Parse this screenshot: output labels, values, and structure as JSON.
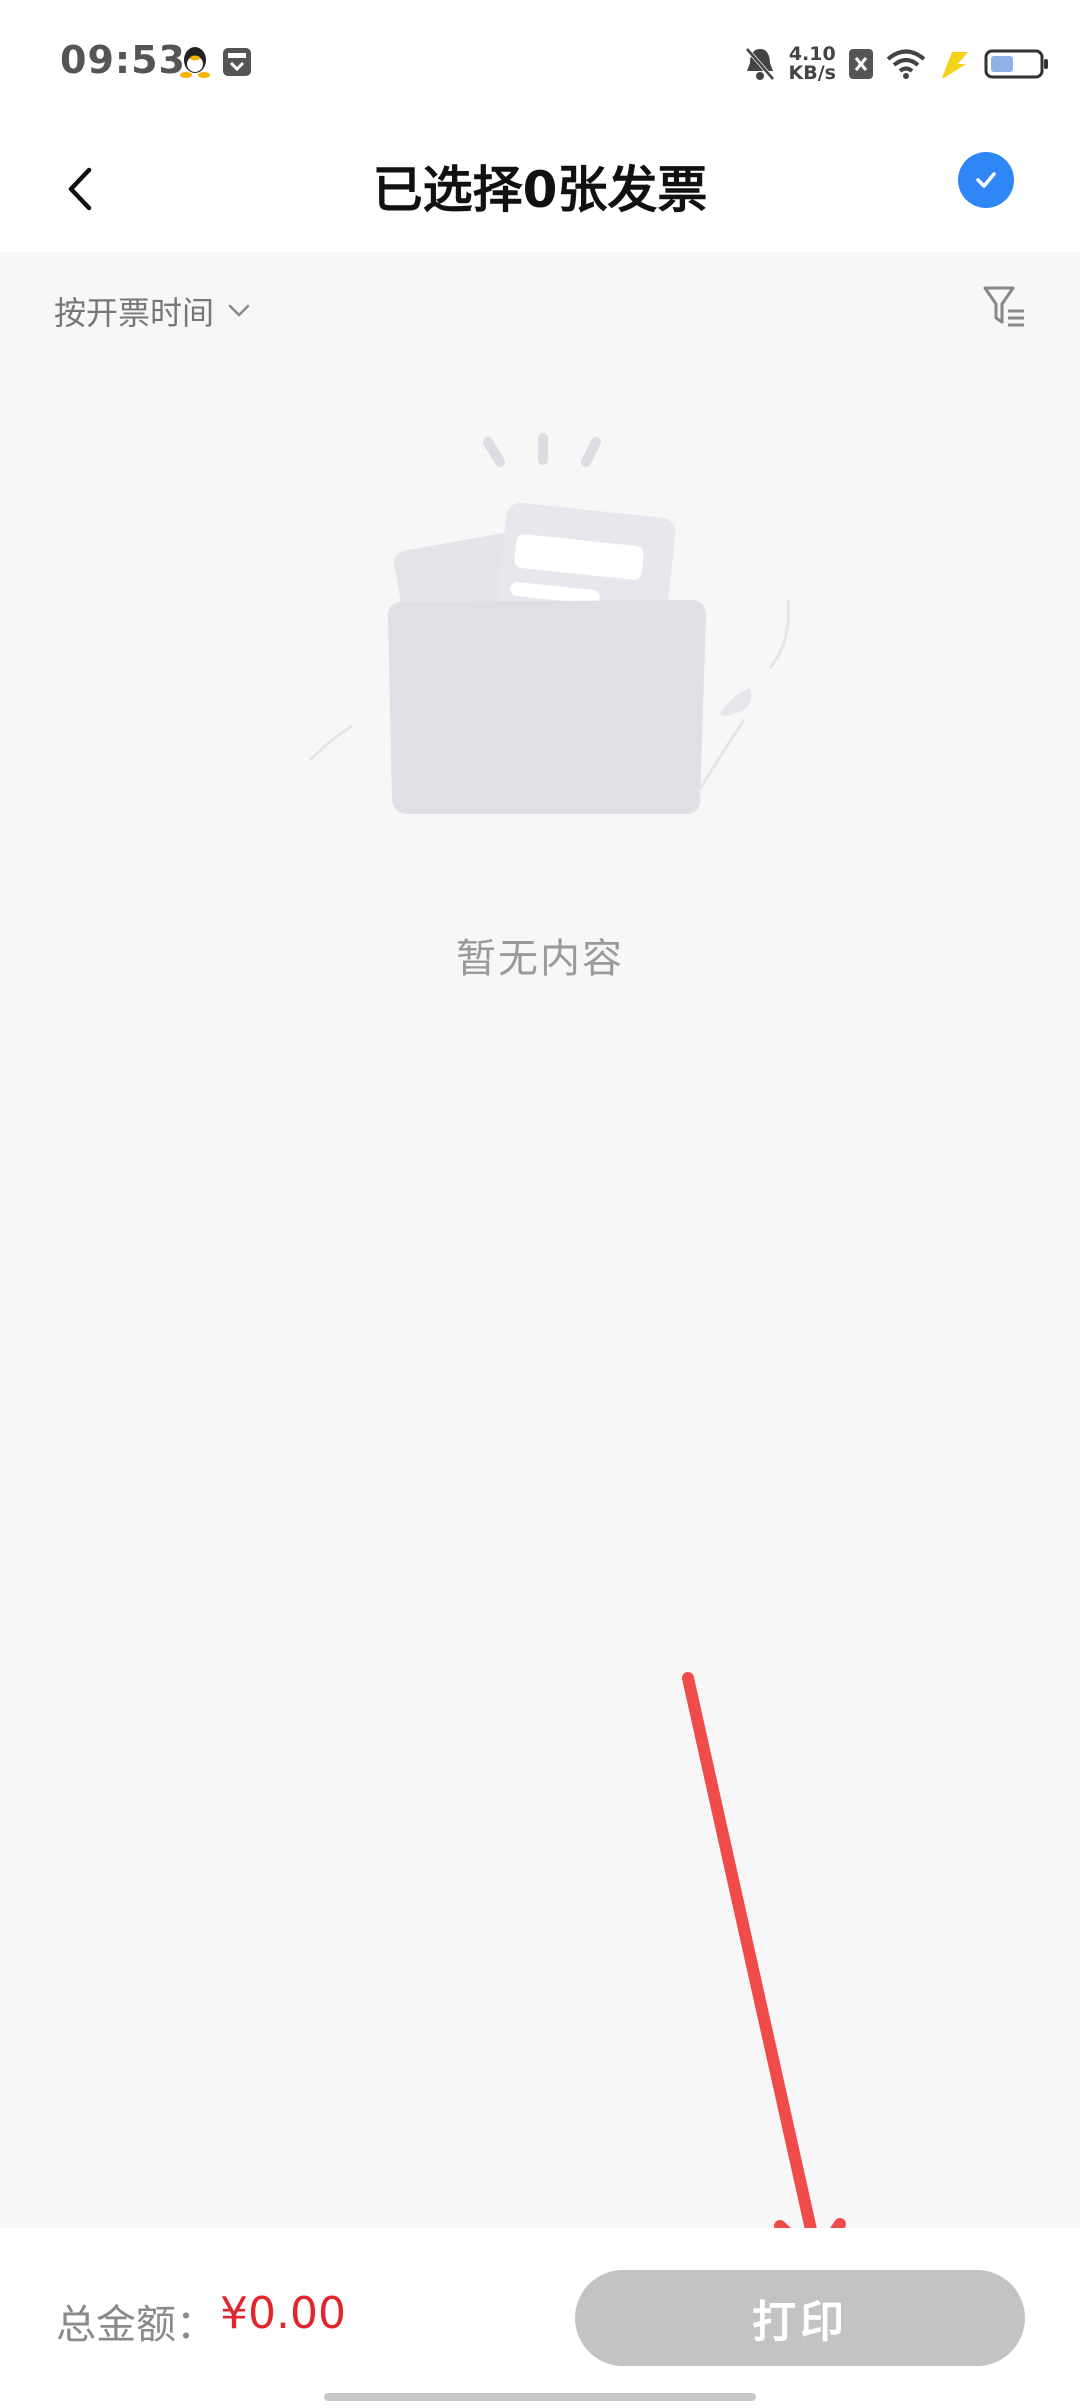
{
  "status_bar": {
    "time": "09:53",
    "net_speed_value": "4.10",
    "net_speed_unit": "KB/s",
    "icons": [
      "qq-icon",
      "app-notification-icon",
      "mute-icon",
      "sim-blocked-icon",
      "wifi-icon",
      "charging-icon",
      "battery-icon"
    ]
  },
  "header": {
    "title": "已选择0张发票",
    "back_icon": "chevron-left-icon",
    "select_all_icon": "check-circle-icon",
    "accent_color": "#2f86f6"
  },
  "filter": {
    "sort_label": "按开票时间",
    "sort_icon": "chevron-down-icon",
    "filter_icon": "filter-icon"
  },
  "empty_state": {
    "text": "暂无内容",
    "illustration": "empty-folder-illustration"
  },
  "bottom_bar": {
    "total_label": "总金额：",
    "total_value": "¥0.00",
    "print_label": "打印",
    "total_color": "#e0262d"
  }
}
